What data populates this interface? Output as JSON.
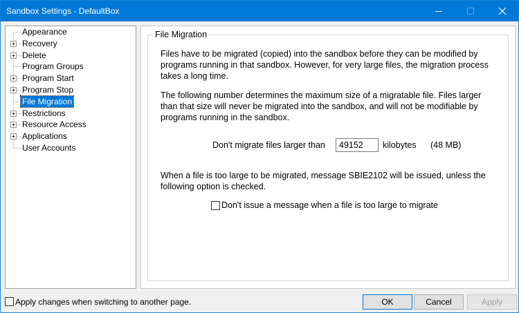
{
  "window": {
    "title": "Sandbox Settings - DefaultBox"
  },
  "tree": {
    "items": [
      {
        "label": "Appearance",
        "expandable": false
      },
      {
        "label": "Recovery",
        "expandable": true
      },
      {
        "label": "Delete",
        "expandable": true
      },
      {
        "label": "Program Groups",
        "expandable": false
      },
      {
        "label": "Program Start",
        "expandable": true
      },
      {
        "label": "Program Stop",
        "expandable": true
      },
      {
        "label": "File Migration",
        "expandable": false,
        "selected": true
      },
      {
        "label": "Restrictions",
        "expandable": true
      },
      {
        "label": "Resource Access",
        "expandable": true
      },
      {
        "label": "Applications",
        "expandable": true
      },
      {
        "label": "User Accounts",
        "expandable": false
      }
    ]
  },
  "panel": {
    "group_title": "File Migration",
    "intro_lines": [
      "Files have to be migrated (copied) into the sandbox before they can be modified by",
      "programs running in that sandbox.  However, for very large files, the migration process",
      "takes a long time."
    ],
    "limit_lines": [
      "The following number determines the maximum size of a migratable file.  Files larger",
      "than that size will never be migrated into the sandbox, and will not be modifiable by",
      "programs running in the sandbox."
    ],
    "size_label": "Don't migrate files larger than",
    "size_value": "49152",
    "size_unit": "kilobytes",
    "size_mb": "(48 MB)",
    "message_lines": [
      "When a file is too large to be migrated, message SBIE2102 will be issued, unless the",
      "following option is checked."
    ],
    "option_label": "Don't issue a message when a file is too large to migrate",
    "option_checked": false
  },
  "footer": {
    "apply_on_switch_label": "Apply changes when switching to another page.",
    "apply_on_switch_checked": false,
    "ok_label": "OK",
    "cancel_label": "Cancel",
    "apply_label": "Apply",
    "apply_enabled": false
  }
}
